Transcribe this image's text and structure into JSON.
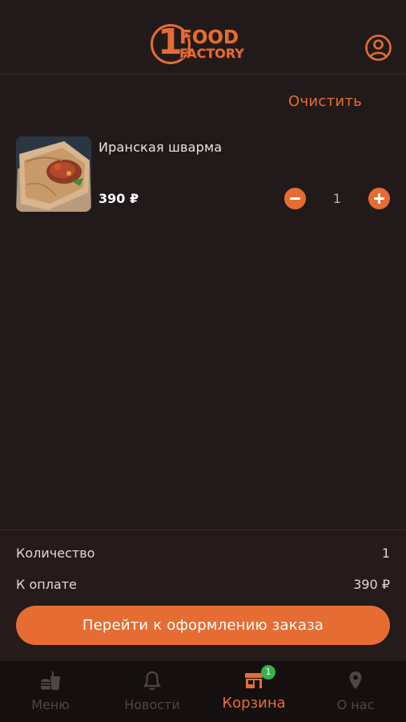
{
  "header": {
    "logo_number": "1",
    "logo_line1": "FOOD",
    "logo_line2": "FACTORY"
  },
  "cart": {
    "clear_label": "Очистить",
    "items": [
      {
        "name": "Иранская шварма",
        "price": "390 ₽",
        "quantity": "1"
      }
    ]
  },
  "summary": {
    "quantity_label": "Количество",
    "quantity_value": "1",
    "total_label": "К оплате",
    "total_value": "390 ₽",
    "checkout_label": "Перейти к оформлению заказа"
  },
  "tabbar": {
    "tabs": [
      {
        "label": "Меню",
        "icon": "burger-drink-icon"
      },
      {
        "label": "Новости",
        "icon": "bell-icon"
      },
      {
        "label": "Корзина",
        "icon": "store-icon"
      },
      {
        "label": "О нас",
        "icon": "location-pin-icon"
      }
    ],
    "active_tab": "Корзина",
    "cart_badge": "1"
  },
  "colors": {
    "accent": "#e56d33",
    "background": "#221a1a",
    "tabbar_background": "#150f0f",
    "badge": "#35b24a"
  }
}
